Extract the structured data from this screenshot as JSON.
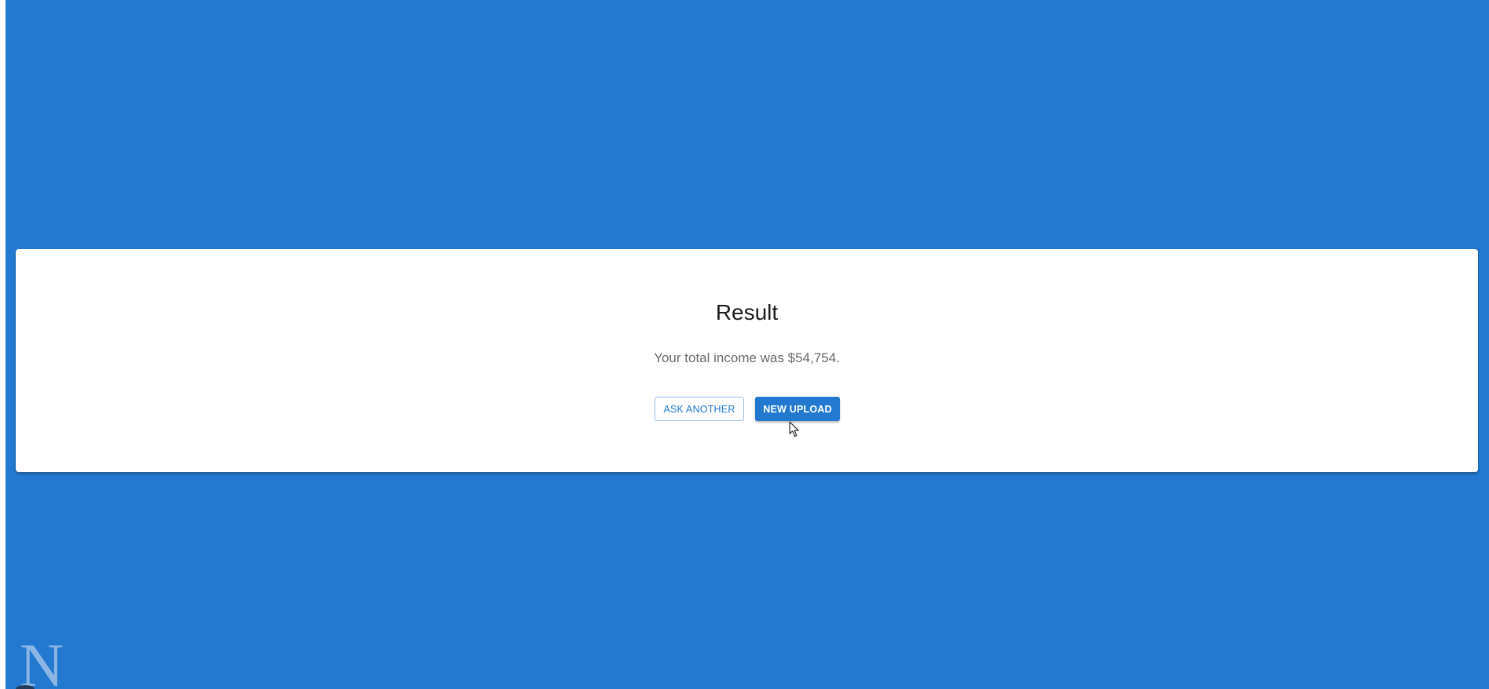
{
  "result": {
    "title": "Result",
    "message": "Your total income was $54,754."
  },
  "actions": {
    "ask_another_label": "ASK ANOTHER",
    "new_upload_label": "NEW UPLOAD"
  },
  "brand": {
    "logo_letter": "N"
  },
  "colors": {
    "background": "#2279cf",
    "card": "#ffffff",
    "accent": "#2279cf"
  },
  "icons": {
    "cursor": "mouse-pointer-icon",
    "logo": "brand-logo-icon"
  }
}
